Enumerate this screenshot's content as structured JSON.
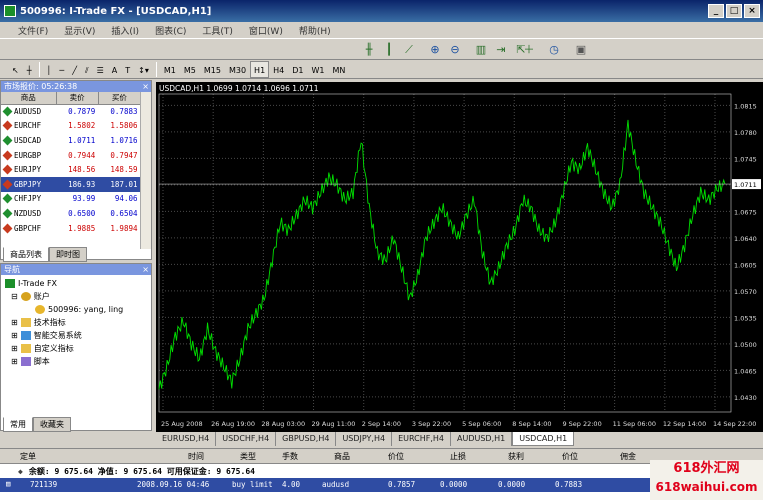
{
  "window": {
    "title": "500996: I-Trade FX - [USDCAD,H1]"
  },
  "menu": [
    "文件(F)",
    "显示(V)",
    "插入(I)",
    "图表(C)",
    "工具(T)",
    "窗口(W)",
    "帮助(H)"
  ],
  "toolbar2": {
    "tools": [
      "A",
      "T"
    ],
    "timeframes": [
      "M1",
      "M5",
      "M15",
      "M30",
      "H1",
      "H4",
      "D1",
      "W1",
      "MN"
    ],
    "active": "H1"
  },
  "market_watch": {
    "title": "市场报价: 05:26:38",
    "columns": [
      "商品",
      "卖价",
      "买价"
    ],
    "rows": [
      {
        "symbol": "AUDUSD",
        "bid": "0.7879",
        "ask": "0.7883",
        "dir": "up"
      },
      {
        "symbol": "EURCHF",
        "bid": "1.5802",
        "ask": "1.5806",
        "dir": "down"
      },
      {
        "symbol": "USDCAD",
        "bid": "1.0711",
        "ask": "1.0716",
        "dir": "up"
      },
      {
        "symbol": "EURGBP",
        "bid": "0.7944",
        "ask": "0.7947",
        "dir": "down"
      },
      {
        "symbol": "EURJPY",
        "bid": "148.56",
        "ask": "148.59",
        "dir": "down"
      },
      {
        "symbol": "GBPJPY",
        "bid": "186.93",
        "ask": "187.01",
        "dir": "down"
      },
      {
        "symbol": "CHFJPY",
        "bid": "93.99",
        "ask": "94.06",
        "dir": "up"
      },
      {
        "symbol": "NZDUSD",
        "bid": "0.6500",
        "ask": "0.6504",
        "dir": "up"
      },
      {
        "symbol": "GBPCHF",
        "bid": "1.9885",
        "ask": "1.9894",
        "dir": "down"
      }
    ],
    "tabs": [
      "商品列表",
      "即时图"
    ]
  },
  "navigator": {
    "title": "导航",
    "root": "I-Trade FX",
    "accounts_label": "账户",
    "account": "500996: yang, ling",
    "items": [
      "技术指标",
      "智能交易系统",
      "自定义指标",
      "脚本"
    ],
    "tabs": [
      "常用",
      "收藏夹"
    ]
  },
  "chart": {
    "header": "USDCAD,H1  1.0699 1.0714 1.0696 1.0711",
    "current_price": "1.0711",
    "tabs": [
      "EURUSD,H4",
      "USDCHF,H4",
      "GBPUSD,H4",
      "USDJPY,H4",
      "EURCHF,H4",
      "AUDUSD,H1",
      "USDCAD,H1"
    ],
    "active_tab": "USDCAD,H1"
  },
  "chart_data": {
    "type": "line",
    "title": "USDCAD,H1",
    "y_ticks": [
      "1.0815",
      "1.0780",
      "1.0745",
      "1.0710",
      "1.0675",
      "1.0640",
      "1.0605",
      "1.0570",
      "1.0535",
      "1.0500",
      "1.0465",
      "1.0430"
    ],
    "x_ticks": [
      "25 Aug 2008",
      "26 Aug 19:00",
      "28 Aug 03:00",
      "29 Aug 11:00",
      "2 Sep 14:00",
      "3 Sep 22:00",
      "5 Sep 06:00",
      "8 Sep 14:00",
      "9 Sep 22:00",
      "11 Sep 06:00",
      "12 Sep 14:00",
      "14 Sep 22:00"
    ],
    "ylim": [
      1.041,
      1.083
    ],
    "values": [
      1.044,
      1.047,
      1.051,
      1.053,
      1.05,
      1.048,
      1.052,
      1.049,
      1.047,
      1.045,
      1.048,
      1.052,
      1.054,
      1.056,
      1.061,
      1.066,
      1.065,
      1.067,
      1.069,
      1.068,
      1.07,
      1.072,
      1.071,
      1.069,
      1.07,
      1.077,
      1.068,
      1.062,
      1.061,
      1.064,
      1.06,
      1.056,
      1.059,
      1.064,
      1.066,
      1.068,
      1.066,
      1.064,
      1.067,
      1.069,
      1.062,
      1.058,
      1.06,
      1.063,
      1.065,
      1.069,
      1.068,
      1.065,
      1.064,
      1.066,
      1.07,
      1.074,
      1.073,
      1.076,
      1.073,
      1.07,
      1.068,
      1.071,
      1.079,
      1.074,
      1.07,
      1.068,
      1.066,
      1.063,
      1.06,
      1.063,
      1.067,
      1.07,
      1.069,
      1.0705,
      1.0711
    ]
  },
  "terminal": {
    "columns": [
      "定单",
      "时间",
      "类型",
      "手数",
      "商品",
      "价位",
      "止损",
      "获利",
      "价位",
      "佣金"
    ],
    "balance": "余额: 9 675.64  净值: 9 675.64  可用保证金: 9 675.64",
    "order": {
      "id": "721139",
      "time": "2008.09.16 04:46",
      "type": "buy limit",
      "lots": "4.00",
      "symbol": "audusd",
      "price": "0.7857",
      "sl": "0.0000",
      "tp": "0.0000",
      "cur": "0.7883"
    }
  },
  "watermark": {
    "line1": "618外汇网",
    "line2": "618waihui.com"
  }
}
